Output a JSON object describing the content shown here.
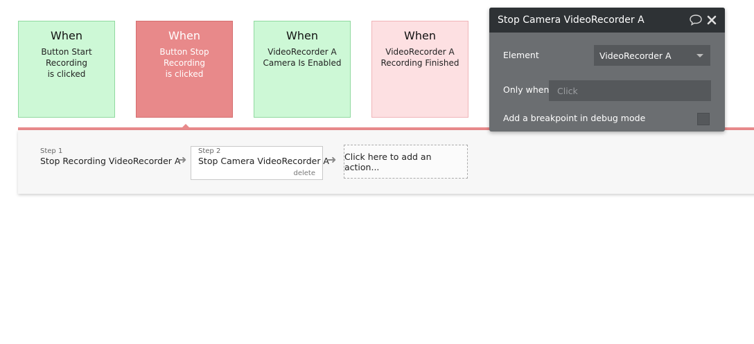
{
  "events": [
    {
      "when": "When",
      "desc": "Button Start Recording\nis clicked"
    },
    {
      "when": "When",
      "desc": "Button Stop Recording\nis clicked"
    },
    {
      "when": "When",
      "desc": "VideoRecorder A\nCamera Is Enabled"
    },
    {
      "when": "When",
      "desc": "VideoRecorder A\nRecording Finished"
    }
  ],
  "steps": [
    {
      "num": "Step 1",
      "title": "Stop Recording VideoRecorder A"
    },
    {
      "num": "Step 2",
      "title": "Stop Camera VideoRecorder A",
      "delete": "delete"
    }
  ],
  "add_action": "Click here to add an action...",
  "panel": {
    "title": "Stop Camera VideoRecorder A",
    "element_label": "Element",
    "element_value": "VideoRecorder A",
    "only_when_label": "Only when",
    "only_when_placeholder": "Click",
    "breakpoint_label": "Add a breakpoint in debug mode"
  },
  "icons": {
    "comment": "comment-icon",
    "close": "close-icon",
    "arrow": "arrow-right-icon",
    "caret": "chevron-down-icon"
  },
  "colors": {
    "event_green": "#cdf8d6",
    "event_red": "#e8898a",
    "event_pink": "#fde0e2",
    "accent_line": "#e88a8b",
    "panel_bg": "#6b6e71",
    "panel_header": "#2e3235"
  }
}
